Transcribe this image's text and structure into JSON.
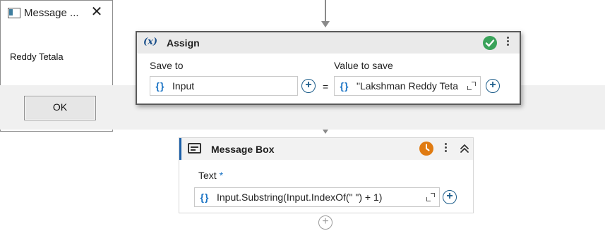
{
  "message_dialog": {
    "title": "Message ...",
    "close_glyph": "✕",
    "body_text": "Reddy Tetala",
    "ok_label": "OK"
  },
  "assign": {
    "icon_text": "(x)",
    "title": "Assign",
    "status": "success",
    "save_to_label": "Save to",
    "save_to_braces": "{}",
    "save_to_value": "Input",
    "equals": "=",
    "value_label": "Value to save",
    "value_braces": "{}",
    "value_value": "\"Lakshman Reddy Teta"
  },
  "message_box": {
    "title": "Message Box",
    "status": "pending",
    "text_label": "Text",
    "required_mark": "*",
    "text_braces": "{}",
    "text_value": "Input.Substring(Input.IndexOf(\" \") + 1)"
  },
  "colors": {
    "accent_blue": "#1a73c4",
    "success_green": "#3aa35a",
    "pending_orange": "#e07b12",
    "selected_border": "#1b5fa8"
  }
}
